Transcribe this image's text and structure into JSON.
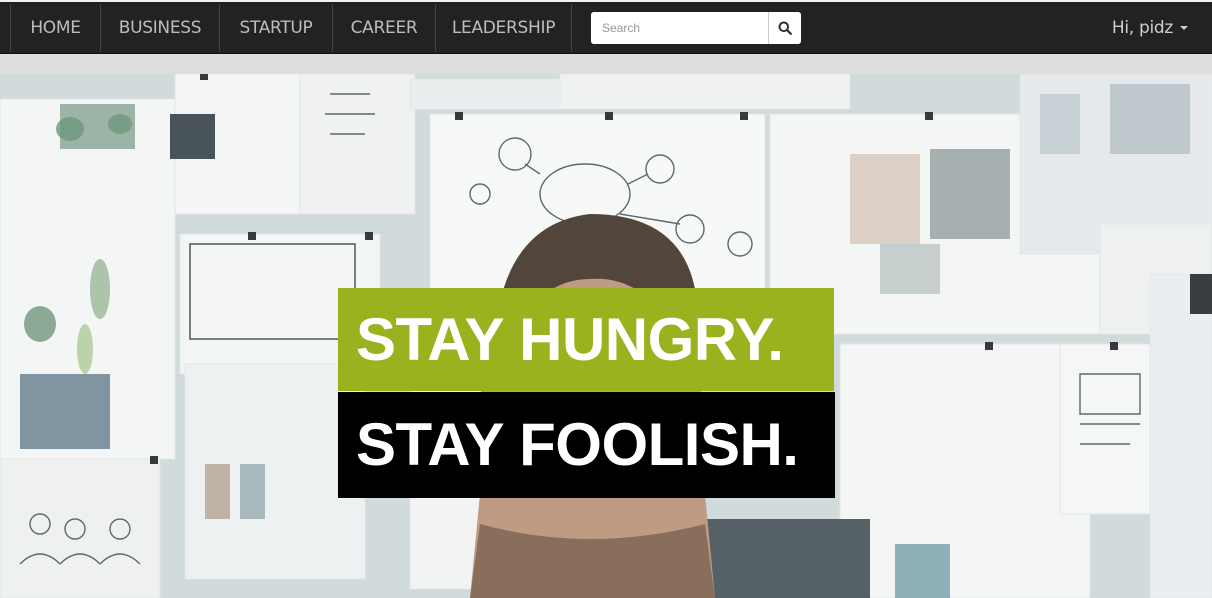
{
  "nav": {
    "items": [
      {
        "label": "HOME"
      },
      {
        "label": "BUSINESS"
      },
      {
        "label": "STARTUP"
      },
      {
        "label": "CAREER"
      },
      {
        "label": "LEADERSHIP"
      }
    ],
    "search": {
      "placeholder": "Search",
      "value": ""
    },
    "user": {
      "greeting": "Hi, pidz"
    }
  },
  "hero": {
    "line1": "STAY HUNGRY.",
    "line2": "STAY FOOLISH.",
    "line1_bg": "#9bb21f",
    "line2_bg": "#000000"
  },
  "icons": {
    "search": "magnifier-icon",
    "caret": "caret-down-icon"
  }
}
